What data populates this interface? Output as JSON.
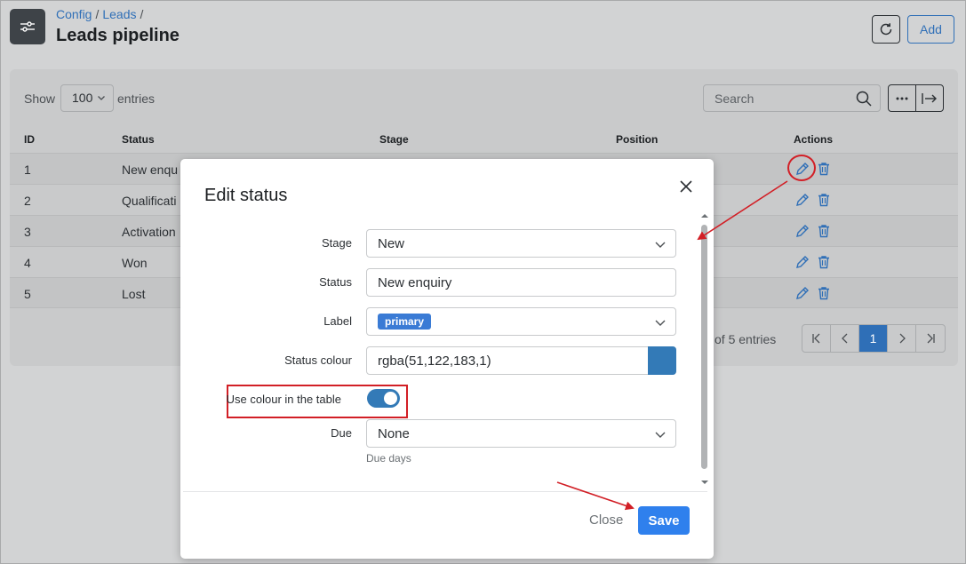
{
  "header": {
    "breadcrumb": [
      "Config",
      "Leads"
    ],
    "breadcrumb_sep": "/",
    "title": "Leads pipeline",
    "add_label": "Add"
  },
  "toolbar": {
    "show_label": "Show",
    "page_size": "100",
    "entries_label": "entries",
    "search_placeholder": "Search"
  },
  "table": {
    "columns": [
      "ID",
      "Status",
      "Stage",
      "Position",
      "Actions"
    ],
    "rows": [
      {
        "id": "1",
        "status": "New enqu"
      },
      {
        "id": "2",
        "status": "Qualificati"
      },
      {
        "id": "3",
        "status": "Activation"
      },
      {
        "id": "4",
        "status": "Won"
      },
      {
        "id": "5",
        "status": "Lost"
      }
    ]
  },
  "pagination": {
    "info": "of 5 entries",
    "current_page": "1"
  },
  "modal": {
    "title": "Edit status",
    "fields": {
      "stage": {
        "label": "Stage",
        "value": "New"
      },
      "status": {
        "label": "Status",
        "value": "New enquiry"
      },
      "label": {
        "label": "Label",
        "value": "primary"
      },
      "status_colour": {
        "label": "Status colour",
        "value": "rgba(51,122,183,1)"
      },
      "use_colour": {
        "label": "Use colour in the table",
        "checked": true
      },
      "due": {
        "label": "Due",
        "value": "None",
        "help": "Due days"
      }
    },
    "close_label": "Close",
    "save_label": "Save"
  },
  "colors": {
    "accent": "#2f80ed",
    "swatch": "#337ab7",
    "highlight": "#d21f26"
  },
  "icons": [
    "sliders-icon",
    "refresh-icon",
    "chevron-down-icon",
    "search-icon",
    "ellipsis-icon",
    "export-icon",
    "edit-icon",
    "trash-icon",
    "first-page-icon",
    "prev-page-icon",
    "next-page-icon",
    "last-page-icon",
    "close-icon",
    "scroll-up-icon",
    "scroll-down-icon"
  ]
}
